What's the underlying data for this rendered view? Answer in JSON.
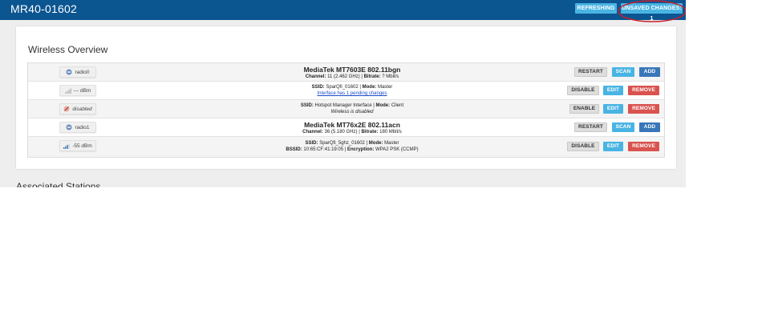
{
  "header": {
    "title": "MR40-01602",
    "refreshing_label": "REFRESHING",
    "unsaved_label": "UNSAVED CHANGES: 1"
  },
  "overview": {
    "title": "Wireless Overview",
    "radio0": {
      "badge": "radio0",
      "title": "MediaTek MT7603E 802.11bgn",
      "channel_label": "Channel:",
      "channel_value": "11 (2.462 GHz) |",
      "bitrate_label": "Bitrate:",
      "bitrate_value": "? Mbit/s",
      "buttons": [
        "RESTART",
        "SCAN",
        "ADD"
      ]
    },
    "net1": {
      "badge": "--- dBm",
      "ssid_label": "SSID:",
      "ssid_value": "SparQfi_01602 |",
      "mode_label": "Mode:",
      "mode_value": "Master",
      "pending_link": "Interface has 1 pending changes",
      "buttons": [
        "DISABLE",
        "EDIT",
        "REMOVE"
      ]
    },
    "net2": {
      "badge": "disabled",
      "ssid_label": "SSID:",
      "ssid_value": "Hotspot Manager Interface |",
      "mode_label": "Mode:",
      "mode_value": "Client",
      "note": "Wireless is disabled",
      "buttons": [
        "ENABLE",
        "EDIT",
        "REMOVE"
      ]
    },
    "radio1": {
      "badge": "radio1",
      "title": "MediaTek MT76x2E 802.11acn",
      "channel_label": "Channel:",
      "channel_value": "36 (5.180 GHz) |",
      "bitrate_label": "Bitrate:",
      "bitrate_value": "180 Mbit/s",
      "buttons": [
        "RESTART",
        "SCAN",
        "ADD"
      ]
    },
    "net3": {
      "badge": "-55 dBm",
      "ssid_label": "SSID:",
      "ssid_value": "SparQfi_5ghz_01602 |",
      "mode_label": "Mode:",
      "mode_value": "Master",
      "bssid_label": "BSSID:",
      "bssid_value": "10:65:CF:41:19:05 |",
      "encryption_label": "Encryption:",
      "encryption_value": "WPA2 PSK (CCMP)",
      "buttons": [
        "DISABLE",
        "EDIT",
        "REMOVE"
      ]
    }
  },
  "associated": {
    "title": "Associated Stations"
  },
  "icons": {
    "radio": "wifi-radio-icon",
    "signal_none": "signal-none-icon",
    "disabled": "wifi-disabled-icon",
    "signal": "signal-bars-icon"
  },
  "colors": {
    "header": "#0b5591",
    "cyan": "#49b4e3",
    "blue": "#3977b8",
    "red": "#d9534f",
    "annotation": "#cc1f2b"
  }
}
